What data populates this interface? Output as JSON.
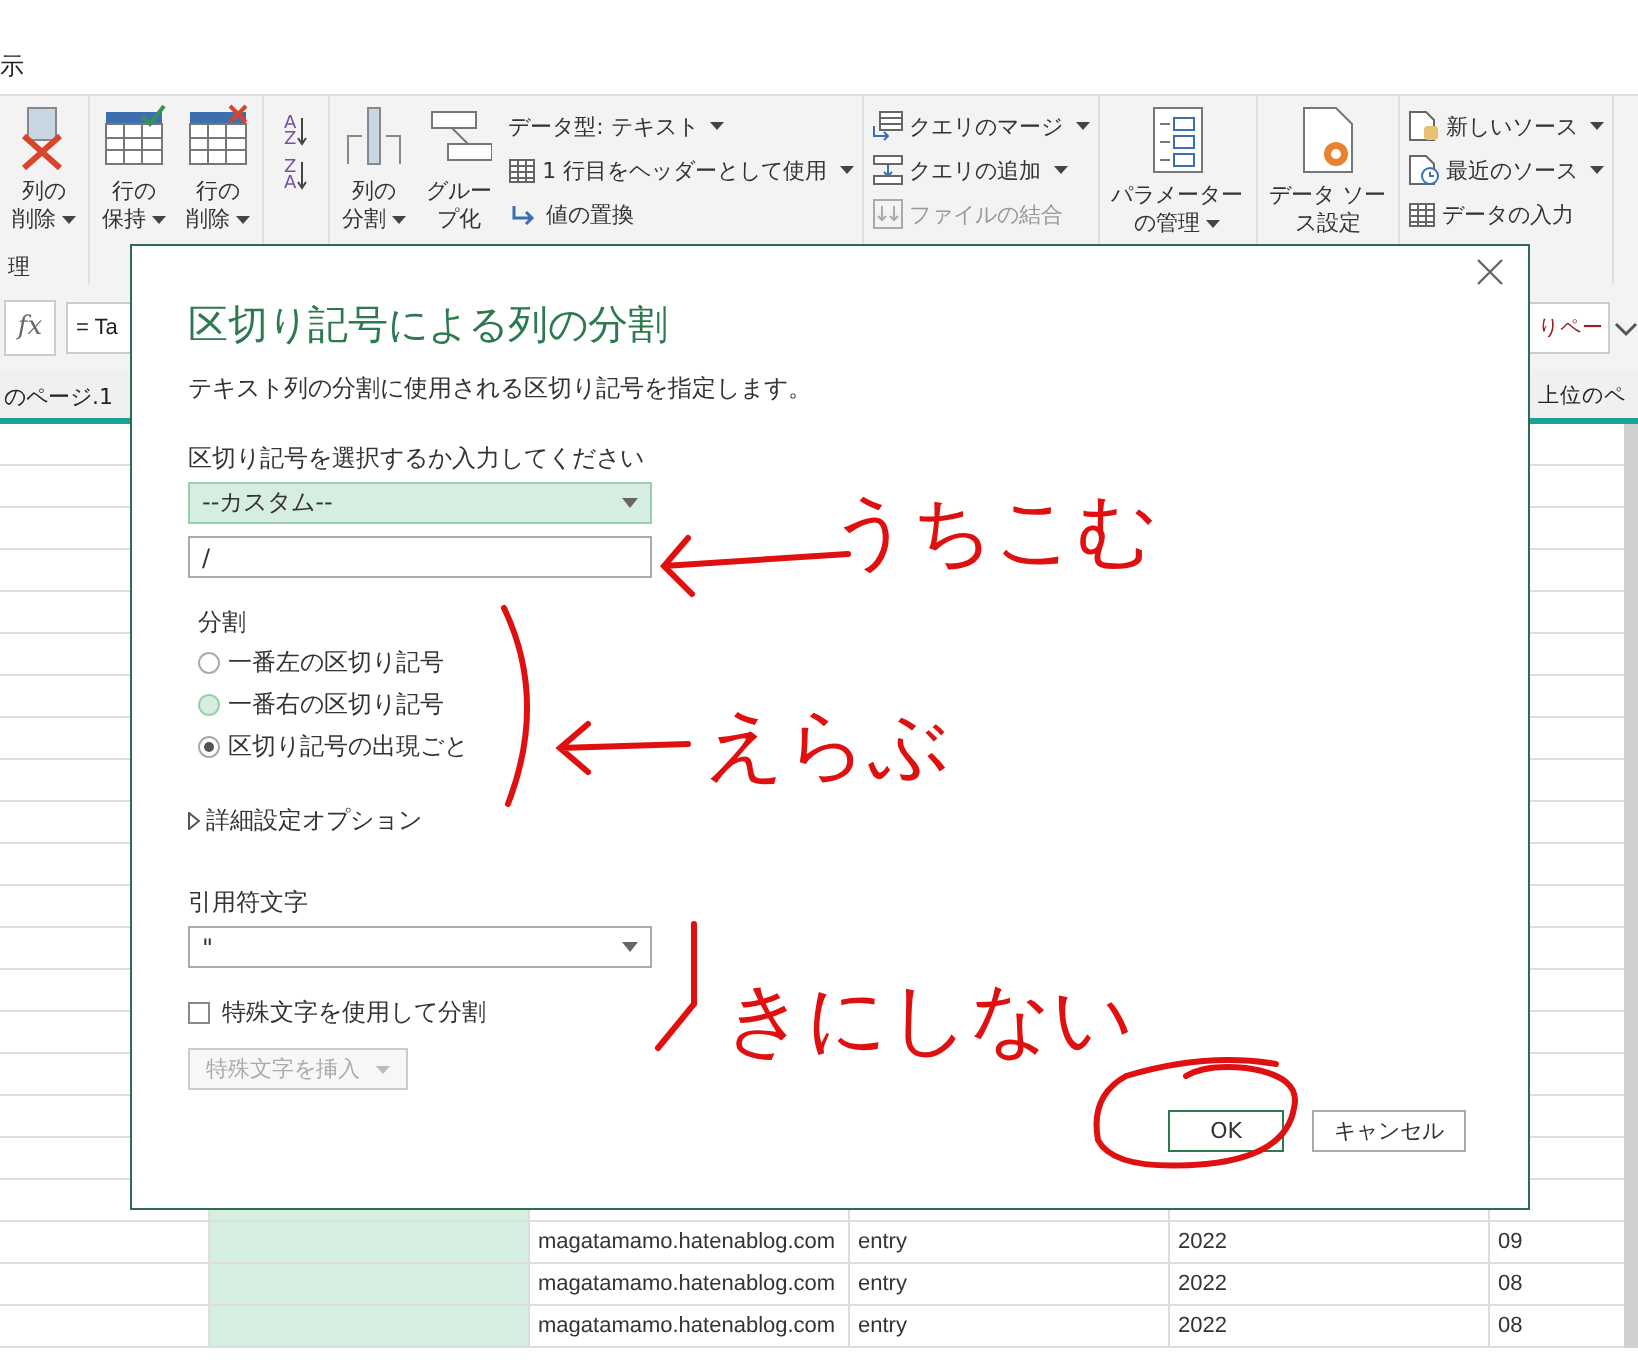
{
  "menu_tab_fragment": "示",
  "ribbon": {
    "groups": [
      {
        "label": "理",
        "items": [
          {
            "kind": "large",
            "lines": [
              "列の",
              "削除"
            ],
            "dropdown": true
          }
        ]
      },
      {
        "items": [
          {
            "kind": "large",
            "lines": [
              "行の",
              "保持"
            ],
            "dropdown": true
          },
          {
            "kind": "large",
            "lines": [
              "行の",
              "削除"
            ],
            "dropdown": true
          }
        ]
      },
      {
        "items": [
          {
            "kind": "sort",
            "top": "A",
            "bottom": "Z"
          },
          {
            "kind": "sort",
            "top": "Z",
            "bottom": "A"
          }
        ]
      },
      {
        "items": [
          {
            "kind": "large",
            "lines": [
              "列の",
              "分割"
            ],
            "dropdown": true
          },
          {
            "kind": "large",
            "lines": [
              "グルー",
              "プ化"
            ],
            "dropdown": false
          },
          {
            "kind": "stack",
            "items": [
              {
                "label": "データ型: テキスト",
                "dropdown": true,
                "disabled": false
              },
              {
                "label": "1 行目をヘッダーとして使用",
                "dropdown": true,
                "disabled": false
              },
              {
                "label": "値の置換",
                "dropdown": false,
                "disabled": false
              }
            ]
          }
        ]
      },
      {
        "items": [
          {
            "kind": "stack",
            "items": [
              {
                "label": "クエリのマージ",
                "dropdown": true,
                "disabled": false
              },
              {
                "label": "クエリの追加",
                "dropdown": true,
                "disabled": false
              },
              {
                "label": "ファイルの結合",
                "dropdown": false,
                "disabled": true
              }
            ]
          }
        ]
      },
      {
        "items": [
          {
            "kind": "large",
            "lines": [
              "パラメーター",
              "の管理"
            ],
            "dropdown": true
          }
        ]
      },
      {
        "items": [
          {
            "kind": "large",
            "lines": [
              "データ ソー",
              "ス設定"
            ],
            "dropdown": false
          }
        ]
      },
      {
        "items": [
          {
            "kind": "stack",
            "items": [
              {
                "label": "新しいソース",
                "dropdown": true,
                "disabled": false
              },
              {
                "label": "最近のソース",
                "dropdown": true,
                "disabled": false
              },
              {
                "label": "データの入力",
                "dropdown": false,
                "disabled": false
              }
            ]
          }
        ]
      }
    ]
  },
  "formula_bar": {
    "fx": "fx",
    "text_left": "= Ta",
    "text_right": "りペー"
  },
  "table": {
    "columns": [
      {
        "header": "のページ.1"
      },
      {},
      {},
      {},
      {},
      {
        "header": "上位のペ"
      }
    ],
    "rows": [
      {
        "cells": [
          "",
          "",
          "magatamamo.hatenablog.com",
          "entry",
          "2022",
          "09"
        ]
      },
      {
        "cells": [
          "",
          "",
          "magatamamo.hatenablog.com",
          "entry",
          "2022",
          "08"
        ]
      },
      {
        "cells": [
          "",
          "",
          "magatamamo.hatenablog.com",
          "entry",
          "2022",
          "08"
        ]
      }
    ]
  },
  "dialog": {
    "title": "区切り記号による列の分割",
    "description": "テキスト列の分割に使用される区切り記号を指定します。",
    "delimiter_label": "区切り記号を選択するか入力してください",
    "delimiter_select": "--カスタム--",
    "delimiter_input": "/",
    "split_label": "分割",
    "split_options": [
      {
        "label": "一番左の区切り記号",
        "selected": false,
        "hovered": false
      },
      {
        "label": "一番右の区切り記号",
        "selected": false,
        "hovered": true
      },
      {
        "label": "区切り記号の出現ごと",
        "selected": true,
        "hovered": false
      }
    ],
    "advanced": {
      "label": "詳細設定オプション",
      "expanded": false
    },
    "quote_label": "引用符文字",
    "quote_select": "\"",
    "special_checkbox": {
      "label": "特殊文字を使用して分割",
      "checked": false
    },
    "insert_special": {
      "label": "特殊文字を挿入",
      "disabled": true
    },
    "buttons": [
      {
        "label": "OK",
        "kind": "primary"
      },
      {
        "label": "キャンセル",
        "kind": "secondary"
      }
    ]
  },
  "annotations": [
    {
      "kind": "arrow",
      "text": "うちこむ"
    },
    {
      "kind": "bracket-arrow",
      "text": "えらぶ"
    },
    {
      "kind": "stroke",
      "text": "きにしない"
    },
    {
      "kind": "circle"
    }
  ]
}
